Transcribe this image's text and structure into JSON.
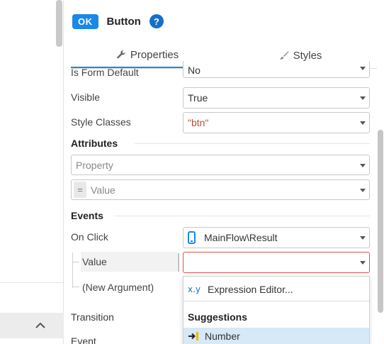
{
  "widget": {
    "badge": "OK",
    "title": "Button",
    "help": "?"
  },
  "tabs": [
    {
      "label": "Properties",
      "icon": "wrench-icon",
      "active": true
    },
    {
      "label": "Styles",
      "icon": "brush-icon",
      "active": false
    }
  ],
  "properties": {
    "is_form_default": {
      "label": "Is Form Default",
      "value": "No"
    },
    "visible": {
      "label": "Visible",
      "value": "True"
    },
    "style_classes": {
      "label": "Style Classes",
      "value": "\"btn\""
    }
  },
  "attributes": {
    "title": "Attributes",
    "property_placeholder": "Property",
    "value_placeholder": "Value",
    "eq": "="
  },
  "events": {
    "title": "Events",
    "on_click": {
      "label": "On Click",
      "value": "MainFlow\\Result",
      "icon": "phone-icon"
    },
    "value_label": "Value",
    "value_field": "",
    "new_argument_label": "(New Argument)",
    "transition_label": "Transition",
    "event_label": "Event"
  },
  "dropdown": {
    "expression_editor": {
      "icon_text": "x.y",
      "label": "Expression Editor..."
    },
    "suggestions_header": "Suggestions",
    "items": [
      {
        "label": "Number",
        "icon": "arrow-into-icon"
      }
    ]
  },
  "colors": {
    "accent": "#1a88e8",
    "string_value": "#b45339",
    "error_border": "#d9534f",
    "selected_bg": "#d7e8f7"
  }
}
